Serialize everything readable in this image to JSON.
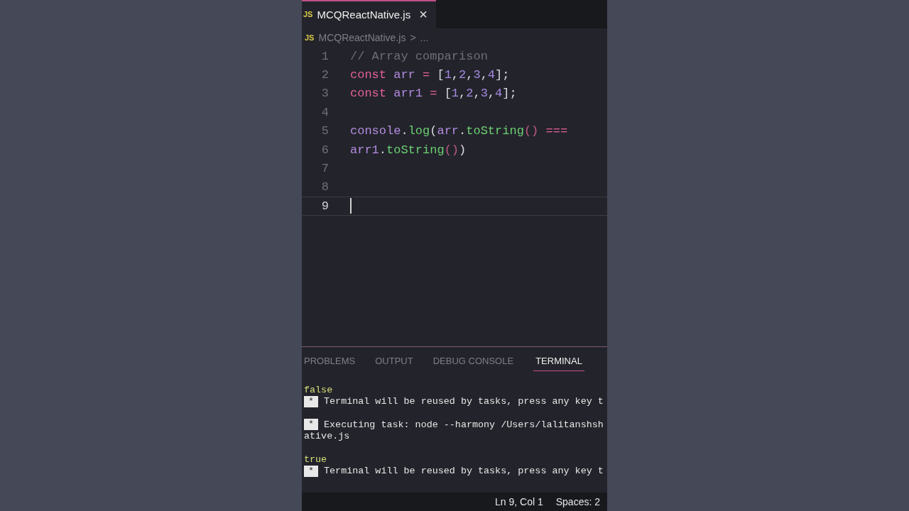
{
  "editor_tabs": [
    {
      "icon_text": "JS",
      "label": "MCQReactNative.js",
      "close": "×",
      "selected": true
    }
  ],
  "breadcrumb": {
    "icon_text": "JS",
    "file": "MCQReactNative.js",
    "separator": ">",
    "rest": "..."
  },
  "code_lines": [
    {
      "number": "1",
      "current": false,
      "tokens": [
        {
          "kind": "comment",
          "text": "// Array comparison"
        }
      ]
    },
    {
      "number": "2",
      "current": false,
      "tokens": [
        {
          "kind": "keyword",
          "text": "const "
        },
        {
          "kind": "var",
          "text": "arr "
        },
        {
          "kind": "op",
          "text": "= "
        },
        {
          "kind": "punct",
          "text": "["
        },
        {
          "kind": "number",
          "text": "1"
        },
        {
          "kind": "punct",
          "text": ","
        },
        {
          "kind": "number",
          "text": "2"
        },
        {
          "kind": "punct",
          "text": ","
        },
        {
          "kind": "number",
          "text": "3"
        },
        {
          "kind": "punct",
          "text": ","
        },
        {
          "kind": "number",
          "text": "4"
        },
        {
          "kind": "punct",
          "text": "];"
        }
      ]
    },
    {
      "number": "3",
      "current": false,
      "tokens": [
        {
          "kind": "keyword",
          "text": "const "
        },
        {
          "kind": "var",
          "text": "arr1 "
        },
        {
          "kind": "op",
          "text": "= "
        },
        {
          "kind": "punct",
          "text": "["
        },
        {
          "kind": "number",
          "text": "1"
        },
        {
          "kind": "punct",
          "text": ","
        },
        {
          "kind": "number",
          "text": "2"
        },
        {
          "kind": "punct",
          "text": ","
        },
        {
          "kind": "number",
          "text": "3"
        },
        {
          "kind": "punct",
          "text": ","
        },
        {
          "kind": "number",
          "text": "4"
        },
        {
          "kind": "punct",
          "text": "];"
        }
      ]
    },
    {
      "number": "4",
      "current": false
    },
    {
      "number": "5",
      "current": false,
      "tokens": [
        {
          "kind": "var",
          "text": "console"
        },
        {
          "kind": "punct",
          "text": "."
        },
        {
          "kind": "func",
          "text": "log"
        },
        {
          "kind": "punct",
          "text": "("
        },
        {
          "kind": "var",
          "text": "arr"
        },
        {
          "kind": "punct",
          "text": "."
        },
        {
          "kind": "func",
          "text": "toString"
        },
        {
          "kind": "paren",
          "text": "() "
        },
        {
          "kind": "op",
          "text": "==="
        }
      ]
    },
    {
      "number": "6",
      "current": false,
      "tokens": [
        {
          "kind": "var",
          "text": "arr1"
        },
        {
          "kind": "punct",
          "text": "."
        },
        {
          "kind": "func",
          "text": "toString"
        },
        {
          "kind": "paren",
          "text": "()"
        },
        {
          "kind": "punct",
          "text": ")"
        }
      ]
    },
    {
      "number": "7",
      "current": false
    },
    {
      "number": "8",
      "current": false
    },
    {
      "number": "9",
      "current": true
    }
  ],
  "panel_tabs": [
    {
      "label": "PROBLEMS",
      "selected": false
    },
    {
      "label": "OUTPUT",
      "selected": false
    },
    {
      "label": "DEBUG CONSOLE",
      "selected": false
    },
    {
      "label": "TERMINAL",
      "selected": true
    }
  ],
  "terminal_lines": [
    {
      "kind": "result",
      "text": "false"
    },
    {
      "kind": "task",
      "badge": "*",
      "text": "Terminal will be reused by tasks, press any key t"
    },
    {
      "kind": "blank"
    },
    {
      "kind": "task",
      "badge": "*",
      "text": "Executing task: node --harmony /Users/lalitanshsh"
    },
    {
      "kind": "plain",
      "text": "ative.js"
    },
    {
      "kind": "blank"
    },
    {
      "kind": "result",
      "text": "true"
    },
    {
      "kind": "task",
      "badge": "*",
      "text": "Terminal will be reused by tasks, press any key t"
    }
  ],
  "status_bar": {
    "position": "Ln 9, Col 1",
    "indent": "Spaces: 2"
  }
}
